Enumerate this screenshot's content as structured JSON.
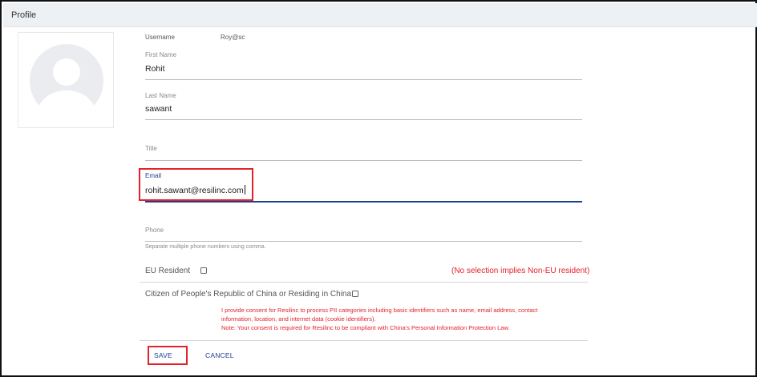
{
  "header": {
    "title": "Profile"
  },
  "profile": {
    "username_label": "Username",
    "username_value": "Roy@sc",
    "first_name_label": "First Name",
    "first_name_value": "Rohit",
    "last_name_label": "Last Name",
    "last_name_value": "sawant",
    "title_placeholder": "Title",
    "email_label": "Email",
    "email_value": "rohit.sawant@resilinc.com",
    "phone_placeholder": "Phone",
    "phone_helper": "Separate multiple phone numbers using comma."
  },
  "eu": {
    "label": "EU Resident",
    "checked": false,
    "note": "(No selection implies Non-EU resident)"
  },
  "china": {
    "label": "Citizen of People's Republic of China or Residing in China",
    "checked": false,
    "consent_line1": "I provide consent for Resilinc to process PII categories including basic identifiers such as name, email address, contact",
    "consent_line2": "information, location, and internet data (cookie identifiers).",
    "consent_line3": "Note: Your consent is required for Resilinc to be compliant with China's Personal Information Protection Law."
  },
  "actions": {
    "save_label": "SAVE",
    "cancel_label": "CANCEL"
  },
  "colors": {
    "accent": "#1d3f8f",
    "highlight": "#e3222b",
    "header_bg": "#eef1f4"
  },
  "icons": {
    "avatar": "user-avatar-icon"
  }
}
